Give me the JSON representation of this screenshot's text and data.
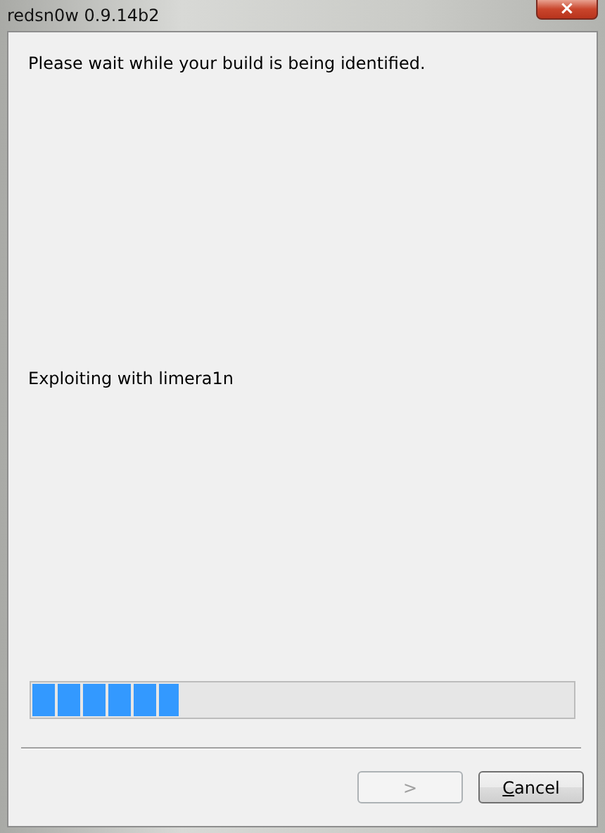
{
  "window": {
    "title": "redsn0w 0.9.14b2",
    "close": "×"
  },
  "message": "Please wait while your build is being identified.",
  "status": "Exploiting with limera1n",
  "progress": {
    "level": 0.27
  },
  "buttons": [
    {
      "label": ">",
      "disabled": true
    },
    {
      "label": "Cancel",
      "disabled": false
    }
  ]
}
